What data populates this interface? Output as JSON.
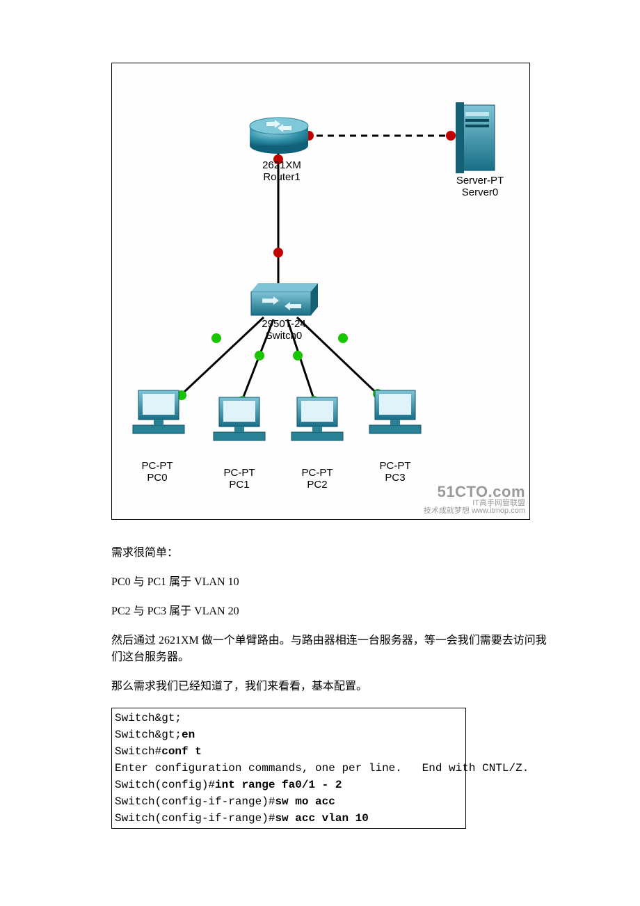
{
  "diagram": {
    "router": {
      "line1": "2621XM",
      "line2": "Router1"
    },
    "server": {
      "line1": "Server-PT",
      "line2": "Server0"
    },
    "switch": {
      "line1": "2950T-24",
      "line2": "Switch0"
    },
    "pc0": {
      "line1": "PC-PT",
      "line2": "PC0"
    },
    "pc1": {
      "line1": "PC-PT",
      "line2": "PC1"
    },
    "pc2": {
      "line1": "PC-PT",
      "line2": "PC2"
    },
    "pc3": {
      "line1": "PC-PT",
      "line2": "PC3"
    },
    "watermark": {
      "big": "51CTO.com",
      "sub1": "IT高手网管联盟",
      "sub2": "技术成就梦想 www.itmop.com"
    }
  },
  "body": {
    "p1": "需求很简单：",
    "p2": "PC0 与 PC1 属于 VLAN 10",
    "p3": "PC2 与 PC3 属于 VLAN 20",
    "p4": "然后通过 2621XM 做一个单臂路由。与路由器相连一台服务器，等一会我们需要去访问我们这台服务器。",
    "p5": "那么需求我们已经知道了，我们来看看，基本配置。"
  },
  "code": {
    "l1": "Switch&gt;",
    "l2_a": "Switch&gt;",
    "l2_b": "en",
    "l3_a": "Switch#",
    "l3_b": "conf t",
    "l4": "Enter configuration commands, one per line.   End with CNTL/Z.",
    "l5_a": "Switch(config)#",
    "l5_b": "int range fa0/1 - 2",
    "l6_a": "Switch(config-if-range)#",
    "l6_b": "sw mo acc",
    "l7_a": "Switch(config-if-range)#",
    "l7_b": "sw acc vlan 10"
  }
}
